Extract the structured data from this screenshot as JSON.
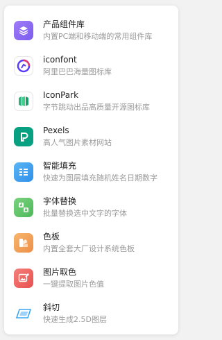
{
  "menu": {
    "items": [
      {
        "title": "产品组件库",
        "desc": "内置PC端和移动端的常用组件库",
        "icon": "layers-icon",
        "color": "#8c6cf0"
      },
      {
        "title": "iconfont",
        "desc": "阿里巴巴海量图标库",
        "icon": "iconfont-logo-icon",
        "color": "#5b3cf5"
      },
      {
        "title": "IconPark",
        "desc": "字节跳动出品高质量开源图标库",
        "icon": "iconpark-logo-icon",
        "color": "#2fb37a"
      },
      {
        "title": "Pexels",
        "desc": "高人气图片素材网站",
        "icon": "pexels-logo-icon",
        "color": "#07a081"
      },
      {
        "title": "智能填充",
        "desc": "快速为图层填充随机姓名日期数字",
        "icon": "smart-fill-icon",
        "color": "#3ea0f0"
      },
      {
        "title": "字体替换",
        "desc": "批量替换选中文字的字体",
        "icon": "font-replace-icon",
        "color": "#5fc26a"
      },
      {
        "title": "色板",
        "desc": "内置全套大厂设计系统色板",
        "icon": "palette-icon",
        "color": "#f2a25a"
      },
      {
        "title": "图片取色",
        "desc": "一键提取图片色值",
        "icon": "image-color-picker-icon",
        "color": "#ef6461"
      },
      {
        "title": "斜切",
        "desc": "快速生成2.5D图层",
        "icon": "skew-icon",
        "color": "#3aa6f2"
      }
    ]
  }
}
